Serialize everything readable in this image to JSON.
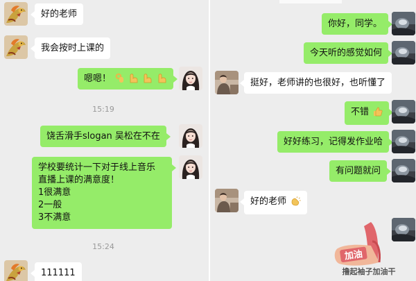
{
  "left": {
    "messages": [
      {
        "text": "好的老师"
      },
      {
        "text": "我会按时上课的"
      },
      {
        "text": "嗯嗯！"
      },
      {
        "text": "饶舌滑手slogan 吴松在不在"
      },
      {
        "lines": [
          "学校要统计一下对于线上音乐",
          "直播上课的满意度！",
          "1很满意",
          "2一般",
          "3不满意"
        ]
      },
      {
        "text": "111111"
      }
    ],
    "times": [
      "15:19",
      "15:24"
    ]
  },
  "right": {
    "messages": [
      {
        "text": "你好，同学。"
      },
      {
        "text": "今天听的感觉如何"
      },
      {
        "text": "挺好，老师讲的也很好，也听懂了"
      },
      {
        "text": "不错"
      },
      {
        "text": "好好练习，记得发作业哈"
      },
      {
        "text": "有问题就问"
      },
      {
        "text": "好的老师"
      }
    ],
    "sticker": {
      "badge": "加油",
      "caption": "撸起袖子加油干"
    }
  },
  "colors": {
    "chat_bg": "#ededed",
    "sent_bubble": "#95ec69",
    "received_bubble": "#ffffff",
    "time_text": "#999999"
  },
  "icons": [
    "ok-hand-emoji",
    "flexed-biceps-emoji",
    "thumbs-up-emoji",
    "clapping-hands-emoji"
  ]
}
